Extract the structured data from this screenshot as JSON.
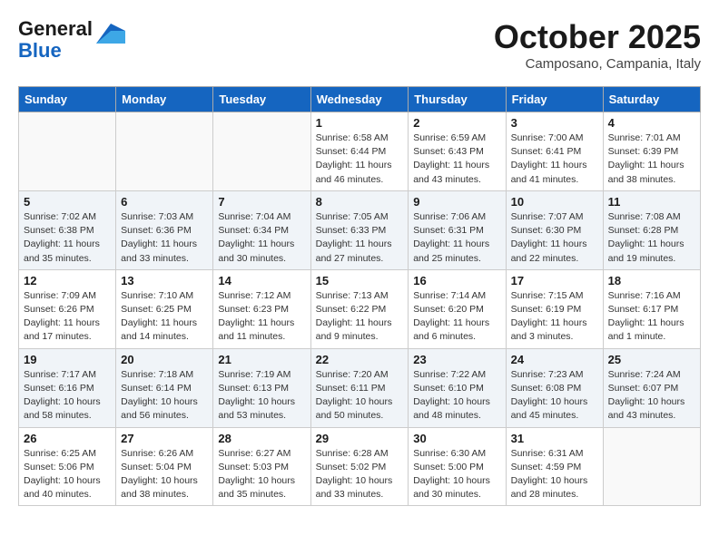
{
  "logo": {
    "line1": "General",
    "line2": "Blue"
  },
  "title": "October 2025",
  "subtitle": "Camposano, Campania, Italy",
  "days_of_week": [
    "Sunday",
    "Monday",
    "Tuesday",
    "Wednesday",
    "Thursday",
    "Friday",
    "Saturday"
  ],
  "weeks": [
    [
      {
        "day": "",
        "info": ""
      },
      {
        "day": "",
        "info": ""
      },
      {
        "day": "",
        "info": ""
      },
      {
        "day": "1",
        "info": "Sunrise: 6:58 AM\nSunset: 6:44 PM\nDaylight: 11 hours\nand 46 minutes."
      },
      {
        "day": "2",
        "info": "Sunrise: 6:59 AM\nSunset: 6:43 PM\nDaylight: 11 hours\nand 43 minutes."
      },
      {
        "day": "3",
        "info": "Sunrise: 7:00 AM\nSunset: 6:41 PM\nDaylight: 11 hours\nand 41 minutes."
      },
      {
        "day": "4",
        "info": "Sunrise: 7:01 AM\nSunset: 6:39 PM\nDaylight: 11 hours\nand 38 minutes."
      }
    ],
    [
      {
        "day": "5",
        "info": "Sunrise: 7:02 AM\nSunset: 6:38 PM\nDaylight: 11 hours\nand 35 minutes."
      },
      {
        "day": "6",
        "info": "Sunrise: 7:03 AM\nSunset: 6:36 PM\nDaylight: 11 hours\nand 33 minutes."
      },
      {
        "day": "7",
        "info": "Sunrise: 7:04 AM\nSunset: 6:34 PM\nDaylight: 11 hours\nand 30 minutes."
      },
      {
        "day": "8",
        "info": "Sunrise: 7:05 AM\nSunset: 6:33 PM\nDaylight: 11 hours\nand 27 minutes."
      },
      {
        "day": "9",
        "info": "Sunrise: 7:06 AM\nSunset: 6:31 PM\nDaylight: 11 hours\nand 25 minutes."
      },
      {
        "day": "10",
        "info": "Sunrise: 7:07 AM\nSunset: 6:30 PM\nDaylight: 11 hours\nand 22 minutes."
      },
      {
        "day": "11",
        "info": "Sunrise: 7:08 AM\nSunset: 6:28 PM\nDaylight: 11 hours\nand 19 minutes."
      }
    ],
    [
      {
        "day": "12",
        "info": "Sunrise: 7:09 AM\nSunset: 6:26 PM\nDaylight: 11 hours\nand 17 minutes."
      },
      {
        "day": "13",
        "info": "Sunrise: 7:10 AM\nSunset: 6:25 PM\nDaylight: 11 hours\nand 14 minutes."
      },
      {
        "day": "14",
        "info": "Sunrise: 7:12 AM\nSunset: 6:23 PM\nDaylight: 11 hours\nand 11 minutes."
      },
      {
        "day": "15",
        "info": "Sunrise: 7:13 AM\nSunset: 6:22 PM\nDaylight: 11 hours\nand 9 minutes."
      },
      {
        "day": "16",
        "info": "Sunrise: 7:14 AM\nSunset: 6:20 PM\nDaylight: 11 hours\nand 6 minutes."
      },
      {
        "day": "17",
        "info": "Sunrise: 7:15 AM\nSunset: 6:19 PM\nDaylight: 11 hours\nand 3 minutes."
      },
      {
        "day": "18",
        "info": "Sunrise: 7:16 AM\nSunset: 6:17 PM\nDaylight: 11 hours\nand 1 minute."
      }
    ],
    [
      {
        "day": "19",
        "info": "Sunrise: 7:17 AM\nSunset: 6:16 PM\nDaylight: 10 hours\nand 58 minutes."
      },
      {
        "day": "20",
        "info": "Sunrise: 7:18 AM\nSunset: 6:14 PM\nDaylight: 10 hours\nand 56 minutes."
      },
      {
        "day": "21",
        "info": "Sunrise: 7:19 AM\nSunset: 6:13 PM\nDaylight: 10 hours\nand 53 minutes."
      },
      {
        "day": "22",
        "info": "Sunrise: 7:20 AM\nSunset: 6:11 PM\nDaylight: 10 hours\nand 50 minutes."
      },
      {
        "day": "23",
        "info": "Sunrise: 7:22 AM\nSunset: 6:10 PM\nDaylight: 10 hours\nand 48 minutes."
      },
      {
        "day": "24",
        "info": "Sunrise: 7:23 AM\nSunset: 6:08 PM\nDaylight: 10 hours\nand 45 minutes."
      },
      {
        "day": "25",
        "info": "Sunrise: 7:24 AM\nSunset: 6:07 PM\nDaylight: 10 hours\nand 43 minutes."
      }
    ],
    [
      {
        "day": "26",
        "info": "Sunrise: 6:25 AM\nSunset: 5:06 PM\nDaylight: 10 hours\nand 40 minutes."
      },
      {
        "day": "27",
        "info": "Sunrise: 6:26 AM\nSunset: 5:04 PM\nDaylight: 10 hours\nand 38 minutes."
      },
      {
        "day": "28",
        "info": "Sunrise: 6:27 AM\nSunset: 5:03 PM\nDaylight: 10 hours\nand 35 minutes."
      },
      {
        "day": "29",
        "info": "Sunrise: 6:28 AM\nSunset: 5:02 PM\nDaylight: 10 hours\nand 33 minutes."
      },
      {
        "day": "30",
        "info": "Sunrise: 6:30 AM\nSunset: 5:00 PM\nDaylight: 10 hours\nand 30 minutes."
      },
      {
        "day": "31",
        "info": "Sunrise: 6:31 AM\nSunset: 4:59 PM\nDaylight: 10 hours\nand 28 minutes."
      },
      {
        "day": "",
        "info": ""
      }
    ]
  ]
}
